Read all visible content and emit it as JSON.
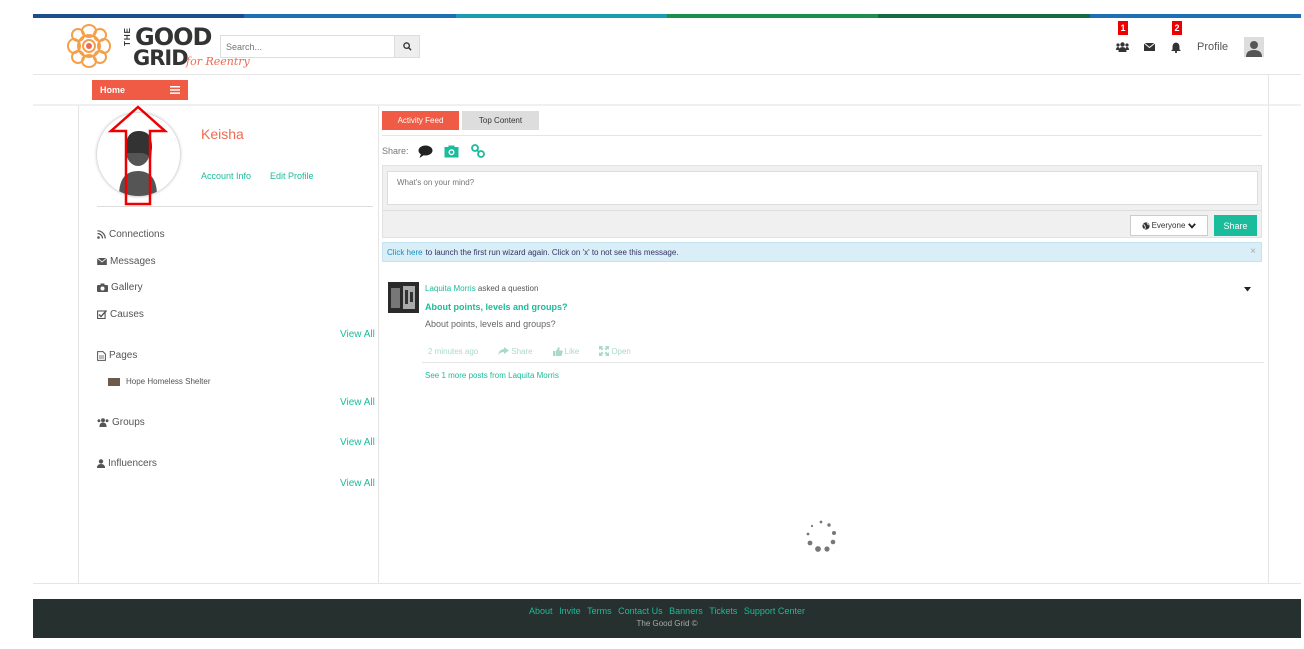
{
  "brand": {
    "logo_the": "THE",
    "logo_good": "GOOD",
    "logo_grid": "GRID",
    "logo_tagline": "for Reentry",
    "strip_colors": [
      "#1a4f8f",
      "#1f6fb8",
      "#1a9cb0",
      "#1c8f4a",
      "#146a42",
      "#1f6fb8"
    ],
    "accent": "#ef5b45",
    "link_color": "#1bbc9b"
  },
  "header": {
    "search_placeholder": "Search...",
    "connections_badge": "1",
    "notifications_badge": "2",
    "profile_label": "Profile"
  },
  "nav": {
    "home_label": "Home"
  },
  "user": {
    "name": "Keisha",
    "account_info": "Account Info",
    "edit_profile": "Edit Profile"
  },
  "sidebar": {
    "connections": "Connections",
    "messages": "Messages",
    "gallery": "Gallery",
    "causes": "Causes",
    "pages": "Pages",
    "page_item": "Hope Homeless Shelter",
    "groups": "Groups",
    "influencers": "Influencers",
    "view_all": "View All"
  },
  "feed": {
    "tab_activity": "Activity Feed",
    "tab_top": "Top Content",
    "share_label": "Share:",
    "textarea_placeholder": "What's on your mind?",
    "audience": "Everyone",
    "share_button": "Share",
    "alert_link": "Click here",
    "alert_text": "to launch the first run wizard again. Click on 'x' to not see this message.",
    "alert_close": "×"
  },
  "post": {
    "author": "Laquita Morris",
    "action": "asked a question",
    "title": "About points, levels and groups?",
    "body": "About points, levels and groups?",
    "time": "2 minutes ago",
    "share": "Share",
    "like": "Like",
    "open": "Open",
    "more": "See 1 more posts from Laquita Morris"
  },
  "footer": {
    "links": [
      "About",
      "Invite",
      "Terms",
      "Contact Us",
      "Banners",
      "Tickets",
      "Support Center"
    ],
    "copyright": "The Good Grid ©"
  }
}
